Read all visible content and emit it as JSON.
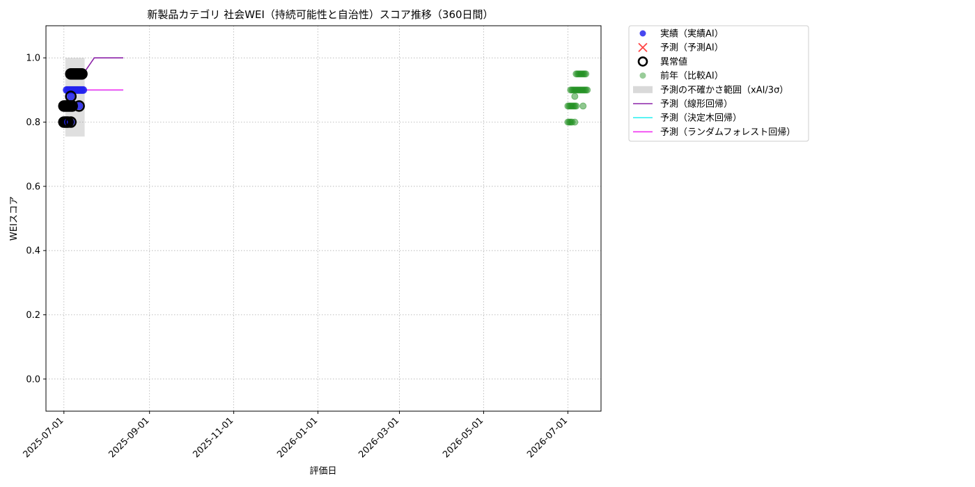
{
  "chart_data": {
    "type": "scatter",
    "title": "新製品カテゴリ 社会WEI（持続可能性と自治性）スコア推移（360日間）",
    "xlabel": "評価日",
    "ylabel": "WEIスコア",
    "xlim": [
      "2025-06-18",
      "2026-07-25"
    ],
    "ylim": [
      -0.1,
      1.1
    ],
    "grid": true,
    "legend_position": "outside-top-right",
    "yticks": [
      0.0,
      0.2,
      0.4,
      0.6,
      0.8,
      1.0
    ],
    "ytick_labels": [
      "0.0",
      "0.2",
      "0.4",
      "0.6",
      "0.8",
      "1.0"
    ],
    "xticks": [
      "2025-07-01",
      "2025-09-01",
      "2025-11-01",
      "2026-01-01",
      "2026-03-01",
      "2026-05-01",
      "2026-07-01"
    ],
    "xtick_labels": [
      "2025-07-01",
      "2025-09-01",
      "2025-11-01",
      "2026-01-01",
      "2026-03-01",
      "2026-05-01",
      "2026-07-01"
    ],
    "legend": [
      {
        "label": "実績（実績AI）",
        "marker": "dot",
        "color": "#3333ee"
      },
      {
        "label": "予測（予測AI）",
        "marker": "x",
        "color": "#ff4444"
      },
      {
        "label": "異常値",
        "marker": "ring",
        "color": "#000000"
      },
      {
        "label": "前年（比較AI）",
        "marker": "dot",
        "color": "#7fbf7f"
      },
      {
        "label": "予測の不確かさ範囲（xAI/3σ）",
        "marker": "patch",
        "color": "#d9d9d9"
      },
      {
        "label": "予測（線形回帰）",
        "marker": "line",
        "color": "#8b22a8"
      },
      {
        "label": "予測（決定木回帰）",
        "marker": "line",
        "color": "#33f0f0"
      },
      {
        "label": "予測（ランダムフォレスト回帰）",
        "marker": "line",
        "color": "#f030f0"
      }
    ],
    "uncertainty_band": {
      "x_start": "2025-07-02",
      "x_end": "2025-07-16",
      "y_low": 0.755,
      "y_high": 1.0
    },
    "series": [
      {
        "name": "実績（実績AI）",
        "kind": "scatter",
        "color": "#2222ee",
        "points": [
          {
            "x": "2025-07-01",
            "y": 0.8
          },
          {
            "x": "2025-07-02",
            "y": 0.8
          },
          {
            "x": "2025-07-03",
            "y": 0.8
          },
          {
            "x": "2025-07-04",
            "y": 0.8
          },
          {
            "x": "2025-07-06",
            "y": 0.8
          },
          {
            "x": "2025-07-01",
            "y": 0.85
          },
          {
            "x": "2025-07-02",
            "y": 0.85
          },
          {
            "x": "2025-07-03",
            "y": 0.85
          },
          {
            "x": "2025-07-04",
            "y": 0.85
          },
          {
            "x": "2025-07-05",
            "y": 0.85
          },
          {
            "x": "2025-07-06",
            "y": 0.85
          },
          {
            "x": "2025-07-07",
            "y": 0.85
          },
          {
            "x": "2025-07-12",
            "y": 0.85
          },
          {
            "x": "2025-07-06",
            "y": 0.88
          },
          {
            "x": "2025-07-03",
            "y": 0.9
          },
          {
            "x": "2025-07-04",
            "y": 0.9
          },
          {
            "x": "2025-07-05",
            "y": 0.9
          },
          {
            "x": "2025-07-06",
            "y": 0.9
          },
          {
            "x": "2025-07-07",
            "y": 0.9
          },
          {
            "x": "2025-07-08",
            "y": 0.9
          },
          {
            "x": "2025-07-09",
            "y": 0.9
          },
          {
            "x": "2025-07-10",
            "y": 0.9
          },
          {
            "x": "2025-07-11",
            "y": 0.9
          },
          {
            "x": "2025-07-12",
            "y": 0.9
          },
          {
            "x": "2025-07-13",
            "y": 0.9
          },
          {
            "x": "2025-07-14",
            "y": 0.9
          },
          {
            "x": "2025-07-15",
            "y": 0.9
          },
          {
            "x": "2025-07-06",
            "y": 0.95
          },
          {
            "x": "2025-07-07",
            "y": 0.95
          },
          {
            "x": "2025-07-08",
            "y": 0.95
          },
          {
            "x": "2025-07-09",
            "y": 0.95
          },
          {
            "x": "2025-07-10",
            "y": 0.95
          },
          {
            "x": "2025-07-11",
            "y": 0.95
          },
          {
            "x": "2025-07-12",
            "y": 0.95
          },
          {
            "x": "2025-07-13",
            "y": 0.95
          },
          {
            "x": "2025-07-14",
            "y": 0.95
          }
        ]
      },
      {
        "name": "異常値",
        "kind": "ring",
        "color": "#000000",
        "points": [
          {
            "x": "2025-07-01",
            "y": 0.8
          },
          {
            "x": "2025-07-02",
            "y": 0.8
          },
          {
            "x": "2025-07-03",
            "y": 0.8
          },
          {
            "x": "2025-07-04",
            "y": 0.8
          },
          {
            "x": "2025-07-06",
            "y": 0.8
          },
          {
            "x": "2025-07-01",
            "y": 0.85
          },
          {
            "x": "2025-07-02",
            "y": 0.85
          },
          {
            "x": "2025-07-03",
            "y": 0.85
          },
          {
            "x": "2025-07-04",
            "y": 0.85
          },
          {
            "x": "2025-07-05",
            "y": 0.85
          },
          {
            "x": "2025-07-06",
            "y": 0.85
          },
          {
            "x": "2025-07-07",
            "y": 0.85
          },
          {
            "x": "2025-07-12",
            "y": 0.85
          },
          {
            "x": "2025-07-06",
            "y": 0.88
          },
          {
            "x": "2025-07-06",
            "y": 0.95
          },
          {
            "x": "2025-07-07",
            "y": 0.95
          },
          {
            "x": "2025-07-08",
            "y": 0.95
          },
          {
            "x": "2025-07-09",
            "y": 0.95
          },
          {
            "x": "2025-07-10",
            "y": 0.95
          },
          {
            "x": "2025-07-11",
            "y": 0.95
          },
          {
            "x": "2025-07-12",
            "y": 0.95
          },
          {
            "x": "2025-07-13",
            "y": 0.95
          },
          {
            "x": "2025-07-14",
            "y": 0.95
          }
        ]
      },
      {
        "name": "前年（比較AI）",
        "kind": "scatter",
        "color": "#1f8f1f",
        "points": [
          {
            "x": "2026-07-01",
            "y": 0.8
          },
          {
            "x": "2026-07-02",
            "y": 0.8
          },
          {
            "x": "2026-07-03",
            "y": 0.8
          },
          {
            "x": "2026-07-04",
            "y": 0.8
          },
          {
            "x": "2026-07-06",
            "y": 0.8
          },
          {
            "x": "2026-07-01",
            "y": 0.85
          },
          {
            "x": "2026-07-02",
            "y": 0.85
          },
          {
            "x": "2026-07-03",
            "y": 0.85
          },
          {
            "x": "2026-07-04",
            "y": 0.85
          },
          {
            "x": "2026-07-05",
            "y": 0.85
          },
          {
            "x": "2026-07-06",
            "y": 0.85
          },
          {
            "x": "2026-07-07",
            "y": 0.85
          },
          {
            "x": "2026-07-12",
            "y": 0.85
          },
          {
            "x": "2026-07-06",
            "y": 0.88
          },
          {
            "x": "2026-07-03",
            "y": 0.9
          },
          {
            "x": "2026-07-04",
            "y": 0.9
          },
          {
            "x": "2026-07-05",
            "y": 0.9
          },
          {
            "x": "2026-07-06",
            "y": 0.9
          },
          {
            "x": "2026-07-07",
            "y": 0.9
          },
          {
            "x": "2026-07-08",
            "y": 0.9
          },
          {
            "x": "2026-07-09",
            "y": 0.9
          },
          {
            "x": "2026-07-10",
            "y": 0.9
          },
          {
            "x": "2026-07-11",
            "y": 0.9
          },
          {
            "x": "2026-07-12",
            "y": 0.9
          },
          {
            "x": "2026-07-13",
            "y": 0.9
          },
          {
            "x": "2026-07-14",
            "y": 0.9
          },
          {
            "x": "2026-07-15",
            "y": 0.9
          },
          {
            "x": "2026-07-07",
            "y": 0.95
          },
          {
            "x": "2026-07-08",
            "y": 0.95
          },
          {
            "x": "2026-07-09",
            "y": 0.95
          },
          {
            "x": "2026-07-10",
            "y": 0.95
          },
          {
            "x": "2026-07-11",
            "y": 0.95
          },
          {
            "x": "2026-07-12",
            "y": 0.95
          },
          {
            "x": "2026-07-13",
            "y": 0.95
          },
          {
            "x": "2026-07-14",
            "y": 0.95
          }
        ]
      },
      {
        "name": "予測（線形回帰）",
        "kind": "line",
        "color": "#8b22a8",
        "points": [
          {
            "x": "2025-07-15",
            "y": 0.95
          },
          {
            "x": "2025-07-23",
            "y": 1.0
          },
          {
            "x": "2025-08-13",
            "y": 1.0
          }
        ]
      },
      {
        "name": "予測（決定木回帰）",
        "kind": "line",
        "color": "#33f0f0",
        "points": [
          {
            "x": "2025-07-15",
            "y": 0.9
          },
          {
            "x": "2025-08-13",
            "y": 0.9
          }
        ]
      },
      {
        "name": "予測（ランダムフォレスト回帰）",
        "kind": "line",
        "color": "#f030f0",
        "points": [
          {
            "x": "2025-07-15",
            "y": 0.9
          },
          {
            "x": "2025-08-13",
            "y": 0.9
          }
        ]
      }
    ]
  }
}
